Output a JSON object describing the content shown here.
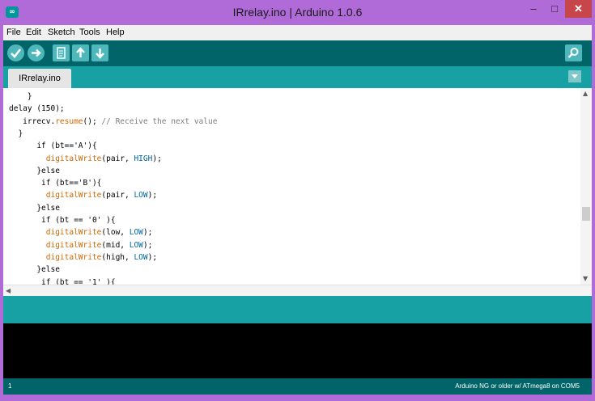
{
  "window": {
    "title": "IRrelay.ino | Arduino 1.0.6",
    "minimize": "–",
    "maximize": "□",
    "close": "✕"
  },
  "menu": [
    "File",
    "Edit",
    "Sketch",
    "Tools",
    "Help"
  ],
  "toolbar": {
    "buttons": [
      "verify",
      "upload",
      "new",
      "open",
      "save"
    ],
    "serial_monitor": "serial-monitor"
  },
  "tab": {
    "label": "IRrelay.ino"
  },
  "code": {
    "lines": [
      [
        {
          "t": "    }",
          "c": ""
        }
      ],
      [
        {
          "t": "delay (150);",
          "c": ""
        }
      ],
      [
        {
          "t": "   irrecv.",
          "c": ""
        },
        {
          "t": "resume",
          "c": "fn"
        },
        {
          "t": "(); ",
          "c": ""
        },
        {
          "t": "// Receive the next value",
          "c": "cm"
        }
      ],
      [
        {
          "t": "  }",
          "c": ""
        }
      ],
      [
        {
          "t": "      if (bt=='A'){",
          "c": ""
        }
      ],
      [
        {
          "t": "        ",
          "c": ""
        },
        {
          "t": "digitalWrite",
          "c": "fn"
        },
        {
          "t": "(pair, ",
          "c": ""
        },
        {
          "t": "HIGH",
          "c": "st"
        },
        {
          "t": ");",
          "c": ""
        }
      ],
      [
        {
          "t": "      }else",
          "c": ""
        }
      ],
      [
        {
          "t": "       if (bt=='B'){",
          "c": ""
        }
      ],
      [
        {
          "t": "        ",
          "c": ""
        },
        {
          "t": "digitalWrite",
          "c": "fn"
        },
        {
          "t": "(pair, ",
          "c": ""
        },
        {
          "t": "LOW",
          "c": "st"
        },
        {
          "t": ");",
          "c": ""
        }
      ],
      [
        {
          "t": "      }else",
          "c": ""
        }
      ],
      [
        {
          "t": "       if (bt == '0' ){",
          "c": ""
        }
      ],
      [
        {
          "t": "        ",
          "c": ""
        },
        {
          "t": "digitalWrite",
          "c": "fn"
        },
        {
          "t": "(low, ",
          "c": ""
        },
        {
          "t": "LOW",
          "c": "st"
        },
        {
          "t": ");",
          "c": ""
        }
      ],
      [
        {
          "t": "        ",
          "c": ""
        },
        {
          "t": "digitalWrite",
          "c": "fn"
        },
        {
          "t": "(mid, ",
          "c": ""
        },
        {
          "t": "LOW",
          "c": "st"
        },
        {
          "t": ");",
          "c": ""
        }
      ],
      [
        {
          "t": "        ",
          "c": ""
        },
        {
          "t": "digitalWrite",
          "c": "fn"
        },
        {
          "t": "(high, ",
          "c": ""
        },
        {
          "t": "LOW",
          "c": "st"
        },
        {
          "t": ");",
          "c": ""
        }
      ],
      [
        {
          "t": "      }else",
          "c": ""
        }
      ],
      [
        {
          "t": "       if (bt == '1' ){",
          "c": ""
        }
      ]
    ]
  },
  "footer": {
    "line_number": "1",
    "board": "Arduino NG or older w/ ATmega8 on COM5"
  },
  "colors": {
    "titlebar": "#b06bd8",
    "toolbar": "#006468",
    "tabbar": "#17a1a5",
    "keyword_function": "#cc6600",
    "constant": "#006699",
    "comment": "#7e7e7e"
  }
}
